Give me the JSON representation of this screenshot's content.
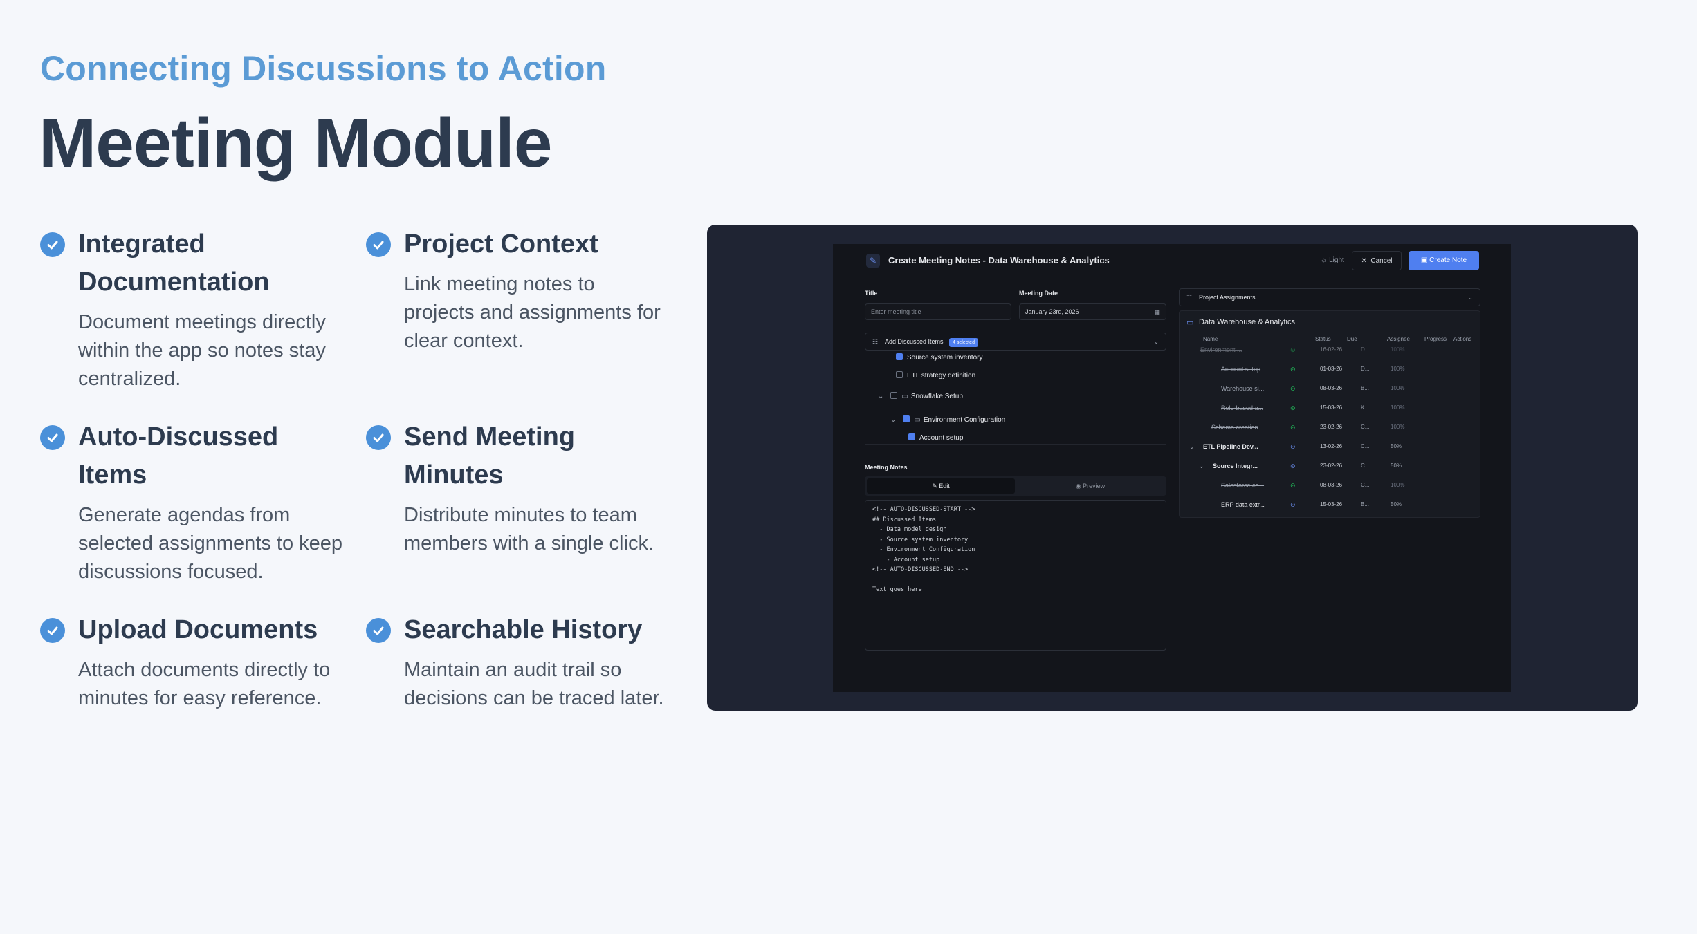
{
  "header": {
    "subtitle": "Connecting Discussions to Action",
    "title": "Meeting Module"
  },
  "features": [
    {
      "title": "Integrated Documentation",
      "desc": "Document meetings directly within the app so notes stay centralized."
    },
    {
      "title": "Project Context",
      "desc": "Link meeting notes to projects and assignments for clear context."
    },
    {
      "title": "Auto-Discussed Items",
      "desc": "Generate agendas from selected assignments to keep discussions focused."
    },
    {
      "title": "Send Meeting Minutes",
      "desc": "Distribute minutes to team members with a single click."
    },
    {
      "title": "Upload Documents",
      "desc": "Attach documents directly to minutes for easy reference."
    },
    {
      "title": "Searchable History",
      "desc": "Maintain an audit trail so decisions can be traced later."
    }
  ],
  "app": {
    "window_title": "Create Meeting Notes - Data Warehouse & Analytics",
    "light_label": "Light",
    "cancel_label": "Cancel",
    "create_label": "Create Note",
    "title_label": "Title",
    "title_placeholder": "Enter meeting title",
    "date_label": "Meeting Date",
    "date_value": "January 23rd, 2026",
    "discussed_label": "Add Discussed Items",
    "discussed_badge": "4 selected",
    "discussed_items": [
      {
        "label": "Source system inventory",
        "checked": true
      },
      {
        "label": "ETL strategy definition",
        "checked": false
      },
      {
        "label": "Snowflake Setup",
        "checked": false
      },
      {
        "label": "Environment Configuration",
        "checked": true
      },
      {
        "label": "Account setup",
        "checked": true
      }
    ],
    "notes_label": "Meeting Notes",
    "tab_edit": "Edit",
    "tab_preview": "Preview",
    "notes_content": "<!-- AUTO-DISCUSSED-START -->\n## Discussed Items\n  - Data model design\n  - Source system inventory\n  - Environment Configuration\n    - Account setup\n<!-- AUTO-DISCUSSED-END -->\n\nText goes here",
    "assignments_label": "Project Assignments",
    "project_name": "Data Warehouse & Analytics",
    "columns": [
      "Name",
      "Status",
      "Due",
      "Assignee",
      "Progress",
      "Actions"
    ],
    "rows": [
      {
        "name": "Environment ...",
        "due": "16-02-26",
        "assignee": "D...",
        "progress": "100%"
      },
      {
        "name": "Account setup",
        "due": "01-03-26",
        "assignee": "D...",
        "progress": "100%"
      },
      {
        "name": "Warehouse si...",
        "due": "08-03-26",
        "assignee": "B...",
        "progress": "100%"
      },
      {
        "name": "Role-based a...",
        "due": "15-03-26",
        "assignee": "K...",
        "progress": "100%"
      },
      {
        "name": "Schema creation",
        "due": "23-02-26",
        "assignee": "C...",
        "progress": "100%"
      },
      {
        "name": "ETL Pipeline Dev...",
        "due": "13-02-26",
        "assignee": "C...",
        "progress": "50%"
      },
      {
        "name": "Source Integr...",
        "due": "23-02-26",
        "assignee": "C...",
        "progress": "50%"
      },
      {
        "name": "Salesforce co...",
        "due": "08-03-26",
        "assignee": "C...",
        "progress": "100%"
      },
      {
        "name": "ERP data extr...",
        "due": "15-03-26",
        "assignee": "B...",
        "progress": "50%"
      }
    ]
  }
}
